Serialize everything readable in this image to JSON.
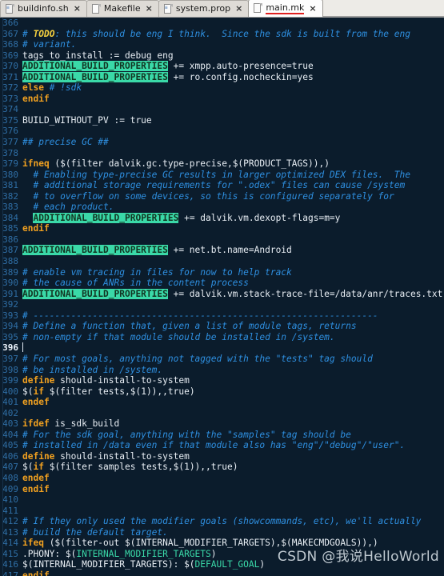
{
  "tabs": [
    {
      "label": "buildinfo.sh",
      "icon": "script-file-icon",
      "close": "×",
      "active": false
    },
    {
      "label": "Makefile",
      "icon": "plain-file-icon",
      "close": "×",
      "active": false
    },
    {
      "label": "system.prop",
      "icon": "properties-file-icon",
      "close": "×",
      "active": false
    },
    {
      "label": "main.mk",
      "icon": "makefile-file-icon",
      "close": "×",
      "active": true
    }
  ],
  "watermark": "CSDN @我说HelloWorld",
  "editor": {
    "first_line": 366,
    "cursor_line": 396,
    "colors": {
      "background": "#0b1c2c",
      "line_number": "#2f6ea5",
      "comment": "#2e8fe0",
      "keyword": "#f0a020",
      "variable": "#3ad9a8",
      "highlight_bg": "#3ad9a8",
      "todo": "#f4d03f",
      "plain_text": "#e8eef4",
      "active_tab_underline": "#e02020"
    },
    "lines": [
      {
        "n": 366,
        "t": []
      },
      {
        "n": 367,
        "t": [
          {
            "s": "# ",
            "k": "c"
          },
          {
            "s": "TODO",
            "k": "todo"
          },
          {
            "s": ": this should be eng I think.  Since the sdk is built from the eng",
            "k": "c"
          }
        ]
      },
      {
        "n": 368,
        "t": [
          {
            "s": "# variant.",
            "k": "c"
          }
        ]
      },
      {
        "n": 369,
        "t": [
          {
            "s": "tags_to_install := debug eng",
            "k": "pl"
          }
        ]
      },
      {
        "n": 370,
        "t": [
          {
            "s": "ADDITIONAL_BUILD_PROPERTIES",
            "k": "hl"
          },
          {
            "s": " += xmpp.auto-presence=true",
            "k": "pl"
          }
        ]
      },
      {
        "n": 371,
        "t": [
          {
            "s": "ADDITIONAL_BUILD_PROPERTIES",
            "k": "hl"
          },
          {
            "s": " += ro.config.nocheckin=yes",
            "k": "pl"
          }
        ]
      },
      {
        "n": 372,
        "t": [
          {
            "s": "else ",
            "k": "kw"
          },
          {
            "s": "# !sdk",
            "k": "c"
          }
        ]
      },
      {
        "n": 373,
        "t": [
          {
            "s": "endif",
            "k": "kw"
          }
        ]
      },
      {
        "n": 374,
        "t": []
      },
      {
        "n": 375,
        "t": [
          {
            "s": "BUILD_WITHOUT_PV := true",
            "k": "pl"
          }
        ]
      },
      {
        "n": 376,
        "t": []
      },
      {
        "n": 377,
        "t": [
          {
            "s": "## precise GC ##",
            "k": "c"
          }
        ]
      },
      {
        "n": 378,
        "t": []
      },
      {
        "n": 379,
        "t": [
          {
            "s": "ifneq ",
            "k": "kw"
          },
          {
            "s": "($(filter dalvik.gc.type-precise,$(PRODUCT_TAGS)),)",
            "k": "pl"
          }
        ]
      },
      {
        "n": 380,
        "t": [
          {
            "s": "  # Enabling type-precise GC results in larger optimized DEX files.  The",
            "k": "c"
          }
        ]
      },
      {
        "n": 381,
        "t": [
          {
            "s": "  # additional storage requirements for \".odex\" files can cause /system",
            "k": "c"
          }
        ]
      },
      {
        "n": 382,
        "t": [
          {
            "s": "  # to overflow on some devices, so this is configured separately for",
            "k": "c"
          }
        ]
      },
      {
        "n": 383,
        "t": [
          {
            "s": "  # each product.",
            "k": "c"
          }
        ]
      },
      {
        "n": 384,
        "t": [
          {
            "s": "  ",
            "k": "pl"
          },
          {
            "s": "ADDITIONAL_BUILD_PROPERTIES",
            "k": "hl"
          },
          {
            "s": " += dalvik.vm.dexopt-flags=m=y",
            "k": "pl"
          }
        ]
      },
      {
        "n": 385,
        "t": [
          {
            "s": "endif",
            "k": "kw"
          }
        ]
      },
      {
        "n": 386,
        "t": []
      },
      {
        "n": 387,
        "t": [
          {
            "s": "ADDITIONAL_BUILD_PROPERTIES",
            "k": "hl"
          },
          {
            "s": " += net.bt.name=Android",
            "k": "pl"
          }
        ]
      },
      {
        "n": 388,
        "t": []
      },
      {
        "n": 389,
        "t": [
          {
            "s": "# enable vm tracing in files for now to help track",
            "k": "c"
          }
        ]
      },
      {
        "n": 390,
        "t": [
          {
            "s": "# the cause of ANRs in the content process",
            "k": "c"
          }
        ]
      },
      {
        "n": 391,
        "t": [
          {
            "s": "ADDITIONAL_BUILD_PROPERTIES",
            "k": "hl"
          },
          {
            "s": " += dalvik.vm.stack-trace-file=/data/anr/traces.txt",
            "k": "pl"
          }
        ]
      },
      {
        "n": 392,
        "t": []
      },
      {
        "n": 393,
        "t": [
          {
            "s": "# ----------------------------------------------------------------",
            "k": "c"
          }
        ]
      },
      {
        "n": 394,
        "t": [
          {
            "s": "# Define a function that, given a list of module tags, returns",
            "k": "c"
          }
        ]
      },
      {
        "n": 395,
        "t": [
          {
            "s": "# non-empty if that module should be installed in /system.",
            "k": "c"
          }
        ]
      },
      {
        "n": 396,
        "t": [],
        "cursor": true
      },
      {
        "n": 397,
        "t": [
          {
            "s": "# For most goals, anything not tagged with the \"tests\" tag should",
            "k": "c"
          }
        ]
      },
      {
        "n": 398,
        "t": [
          {
            "s": "# be installed in /system.",
            "k": "c"
          }
        ]
      },
      {
        "n": 399,
        "t": [
          {
            "s": "define ",
            "k": "kw"
          },
          {
            "s": "should-install-to-system",
            "k": "pl"
          }
        ]
      },
      {
        "n": 400,
        "t": [
          {
            "s": "$(",
            "k": "pl"
          },
          {
            "s": "if",
            "k": "kw"
          },
          {
            "s": " $(filter tests,$(1)),,true)",
            "k": "pl"
          }
        ]
      },
      {
        "n": 401,
        "t": [
          {
            "s": "endef",
            "k": "kw"
          }
        ]
      },
      {
        "n": 402,
        "t": []
      },
      {
        "n": 403,
        "t": [
          {
            "s": "ifdef ",
            "k": "kw"
          },
          {
            "s": "is_sdk_build",
            "k": "pl"
          }
        ]
      },
      {
        "n": 404,
        "t": [
          {
            "s": "# For the sdk goal, anything with the \"samples\" tag should be",
            "k": "c"
          }
        ]
      },
      {
        "n": 405,
        "t": [
          {
            "s": "# installed in /data even if that module also has \"eng\"/\"debug\"/\"user\".",
            "k": "c"
          }
        ]
      },
      {
        "n": 406,
        "t": [
          {
            "s": "define ",
            "k": "kw"
          },
          {
            "s": "should-install-to-system",
            "k": "pl"
          }
        ]
      },
      {
        "n": 407,
        "t": [
          {
            "s": "$(",
            "k": "pl"
          },
          {
            "s": "if",
            "k": "kw"
          },
          {
            "s": " $(filter samples tests,$(1)),,true)",
            "k": "pl"
          }
        ]
      },
      {
        "n": 408,
        "t": [
          {
            "s": "endef",
            "k": "kw"
          }
        ]
      },
      {
        "n": 409,
        "t": [
          {
            "s": "endif",
            "k": "kw"
          }
        ]
      },
      {
        "n": 410,
        "t": []
      },
      {
        "n": 411,
        "t": []
      },
      {
        "n": 412,
        "t": [
          {
            "s": "# If they only used the modifier goals (showcommands, etc), we'll actually",
            "k": "c"
          }
        ]
      },
      {
        "n": 413,
        "t": [
          {
            "s": "# build the default target.",
            "k": "c"
          }
        ]
      },
      {
        "n": 414,
        "t": [
          {
            "s": "ifeq ",
            "k": "kw"
          },
          {
            "s": "($(filter-out $(INTERNAL_MODIFIER_TARGETS),$(MAKECMDGOALS)),)",
            "k": "pl"
          }
        ]
      },
      {
        "n": 415,
        "t": [
          {
            "s": ".PHONY: $(",
            "k": "pl"
          },
          {
            "s": "INTERNAL_MODIFIER_TARGETS",
            "k": "var"
          },
          {
            "s": ")",
            "k": "pl"
          }
        ]
      },
      {
        "n": 416,
        "t": [
          {
            "s": "$(INTERNAL_MODIFIER_TARGETS): $(",
            "k": "pl"
          },
          {
            "s": "DEFAULT_GOAL",
            "k": "var"
          },
          {
            "s": ")",
            "k": "pl"
          }
        ]
      },
      {
        "n": 417,
        "t": [
          {
            "s": "endif",
            "k": "kw"
          }
        ]
      }
    ]
  }
}
